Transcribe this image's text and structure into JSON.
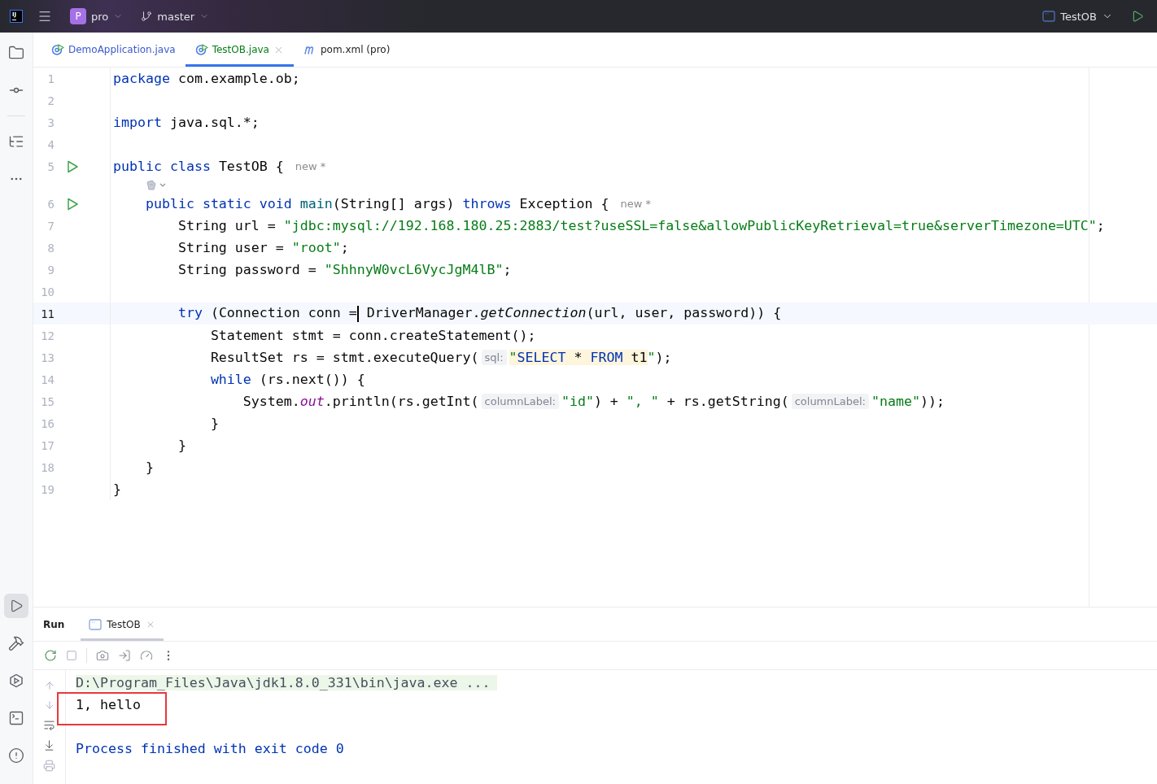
{
  "topbar": {
    "logo": "IJ",
    "project": {
      "initial": "P",
      "name": "pro"
    },
    "branch": "master",
    "run_config": "TestOB"
  },
  "editor_tabs": [
    {
      "label": "DemoApplication.java",
      "kind": "class",
      "selected": false,
      "color": "#3b5bcd"
    },
    {
      "label": "TestOB.java",
      "kind": "class",
      "selected": true,
      "color": "#067d17"
    },
    {
      "label": "pom.xml (pro)",
      "kind": "maven",
      "selected": false,
      "color": "#1e1f22"
    }
  ],
  "code_lines": [
    {
      "number": "1",
      "tokens": [
        {
          "kind": "kw",
          "text": "package "
        },
        {
          "kind": "plain",
          "text": "com.example.ob;"
        }
      ]
    },
    {
      "number": "2"
    },
    {
      "number": "3",
      "tokens": [
        {
          "kind": "kw",
          "text": "import "
        },
        {
          "kind": "plain",
          "text": "java.sql.*;"
        }
      ]
    },
    {
      "number": "4"
    },
    {
      "number": "5",
      "runnable": true,
      "tokens": [
        {
          "kind": "kw",
          "text": "public class "
        },
        {
          "kind": "plain",
          "text": "TestOB {"
        },
        {
          "kind": "inlay",
          "text": "new *"
        }
      ]
    },
    {
      "number": "6",
      "runnable": true,
      "code_vision": true,
      "tokens": [
        {
          "kind": "kw",
          "text": "    public static void "
        },
        {
          "kind": "decl",
          "text": "main"
        },
        {
          "kind": "plain",
          "text": "(String[] args) "
        },
        {
          "kind": "kw",
          "text": "throws "
        },
        {
          "kind": "plain",
          "text": "Exception {"
        },
        {
          "kind": "inlay",
          "text": "new *"
        }
      ]
    },
    {
      "number": "7",
      "tokens": [
        {
          "kind": "plain",
          "text": "        String url = "
        },
        {
          "kind": "str",
          "text": "\"jdbc:mysql://192.168.180.25:2883/test?useSSL=false&allowPublicKeyRetrieval=true&serverTimezone=UTC\""
        },
        {
          "kind": "plain",
          "text": ";"
        }
      ]
    },
    {
      "number": "8",
      "tokens": [
        {
          "kind": "plain",
          "text": "        String user = "
        },
        {
          "kind": "str",
          "text": "\"root\""
        },
        {
          "kind": "plain",
          "text": ";"
        }
      ]
    },
    {
      "number": "9",
      "tokens": [
        {
          "kind": "plain",
          "text": "        String password = "
        },
        {
          "kind": "str",
          "text": "\"ShhnyW0vcL6VycJgM4lB\""
        },
        {
          "kind": "plain",
          "text": ";"
        }
      ]
    },
    {
      "number": "10"
    },
    {
      "number": "11",
      "current": true,
      "tokens": [
        {
          "kind": "kw",
          "text": "        try "
        },
        {
          "kind": "plain",
          "text": "(Connection conn ="
        },
        {
          "kind": "caret"
        },
        {
          "kind": "plain",
          "text": " DriverManager."
        },
        {
          "kind": "italic",
          "text": "getConnection"
        },
        {
          "kind": "plain",
          "text": "(url, user, password)) {"
        }
      ]
    },
    {
      "number": "12",
      "tokens": [
        {
          "kind": "plain",
          "text": "            Statement stmt = conn.createStatement();"
        }
      ]
    },
    {
      "number": "13",
      "tokens": [
        {
          "kind": "plain",
          "text": "            ResultSet rs = stmt.executeQuery("
        },
        {
          "kind": "hint",
          "text": "sql:"
        },
        {
          "kind": "inj_str",
          "text": "\""
        },
        {
          "kind": "inj_kw",
          "text": "SELECT"
        },
        {
          "kind": "inj",
          "text": " * "
        },
        {
          "kind": "inj_kw",
          "text": "FROM"
        },
        {
          "kind": "inj",
          "text": " t1"
        },
        {
          "kind": "str",
          "text": "\""
        },
        {
          "kind": "plain",
          "text": ");"
        }
      ]
    },
    {
      "number": "14",
      "tokens": [
        {
          "kind": "kw",
          "text": "            while "
        },
        {
          "kind": "plain",
          "text": "(rs.next()) {"
        }
      ]
    },
    {
      "number": "15",
      "tokens": [
        {
          "kind": "plain",
          "text": "                System."
        },
        {
          "kind": "field",
          "text": "out"
        },
        {
          "kind": "plain",
          "text": ".println(rs.getInt("
        },
        {
          "kind": "hint",
          "text": "columnLabel:"
        },
        {
          "kind": "str",
          "text": "\"id\""
        },
        {
          "kind": "plain",
          "text": ") + "
        },
        {
          "kind": "str",
          "text": "\", \""
        },
        {
          "kind": "plain",
          "text": " + rs.getString("
        },
        {
          "kind": "hint",
          "text": "columnLabel:"
        },
        {
          "kind": "str",
          "text": "\"name\""
        },
        {
          "kind": "plain",
          "text": "));"
        }
      ]
    },
    {
      "number": "16",
      "tokens": [
        {
          "kind": "plain",
          "text": "            }"
        }
      ]
    },
    {
      "number": "17",
      "tokens": [
        {
          "kind": "plain",
          "text": "        }"
        }
      ]
    },
    {
      "number": "18",
      "tokens": [
        {
          "kind": "plain",
          "text": "    }"
        }
      ]
    },
    {
      "number": "19",
      "tokens": [
        {
          "kind": "plain",
          "text": "}"
        }
      ]
    }
  ],
  "run_panel": {
    "title": "Run",
    "tabs": [
      {
        "label": "TestOB",
        "selected": true
      }
    ],
    "console": [
      {
        "kind": "command",
        "text": "D:\\Program_Files\\Java\\jdk1.8.0_331\\bin\\java.exe ..."
      },
      {
        "kind": "output",
        "text": "1, hello",
        "marked": true
      },
      {
        "kind": "blank"
      },
      {
        "kind": "exit",
        "text": "Process finished with exit code 0"
      }
    ]
  }
}
